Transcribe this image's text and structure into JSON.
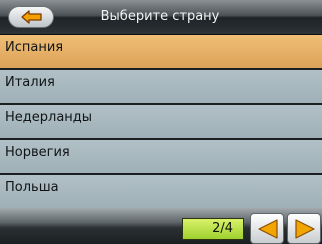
{
  "header": {
    "title": "Выберите страну",
    "back_icon": "arrow-left-icon"
  },
  "countries": [
    {
      "label": "Испания",
      "selected": true
    },
    {
      "label": "Италия",
      "selected": false
    },
    {
      "label": "Недерланды",
      "selected": false
    },
    {
      "label": "Норвегия",
      "selected": false
    },
    {
      "label": "Польша",
      "selected": false
    }
  ],
  "footer": {
    "page_indicator": "2/4",
    "prev_icon": "triangle-left-icon",
    "next_icon": "triangle-right-icon"
  },
  "colors": {
    "selected_row": "#e2aa62",
    "row": "#a8b8be",
    "page_badge": "#b8e04a",
    "nav_arrow": "#f2a400"
  }
}
